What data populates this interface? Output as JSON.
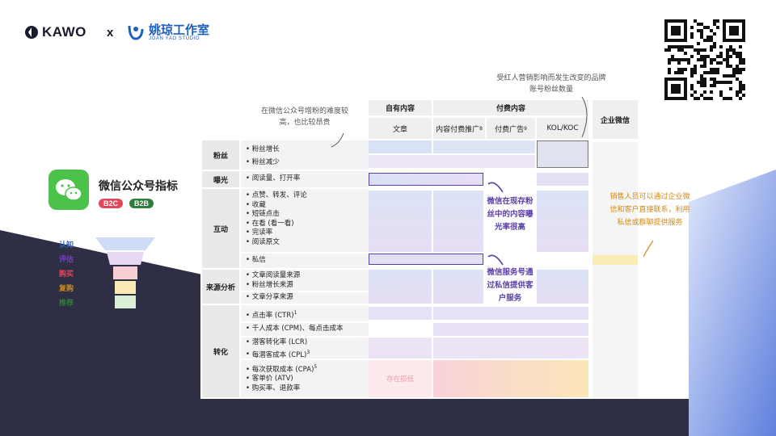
{
  "header": {
    "kawo_brand": "KAWO",
    "cross": "x",
    "partner_cn": "姚琼工作室",
    "partner_en": "JOAN YAO STUDIO"
  },
  "wechat": {
    "title": "微信公众号指标",
    "badge_b2c": "B2C",
    "badge_b2b": "B2B"
  },
  "funnel": [
    "认知",
    "评估",
    "购买",
    "复购",
    "推荐"
  ],
  "notes": {
    "top_left": "在微信公众号增粉的难度较高，也比较昂贵",
    "top_right": "受红人营销影响而发生改变的品牌账号粉丝数量",
    "exposure": "微信在现存粉丝中的内容曝光率很高",
    "service": "微信服务号通过私信提供客户服务",
    "sales": "销售人员可以通过企业微信和客户直接联系，利用私信或群聊提供服务"
  },
  "table": {
    "group_owned": "自有内容",
    "group_paid": "付费内容",
    "col_article": "文章",
    "col_paid_promo": "内容付费推广",
    "col_paid_promo_sup": "8",
    "col_paid_ads": "付费广告",
    "col_paid_ads_sup": "9",
    "col_kol": "KOL/KOC",
    "col_enterprise": "企业微信",
    "cat_fans": "粉丝",
    "cat_exposure": "曝光",
    "cat_engagement": "互动",
    "cat_source": "来源分析",
    "cat_conversion": "转化",
    "m_fans": [
      "粉丝增长",
      "粉丝减少"
    ],
    "m_exposure": [
      "阅读量、打开率"
    ],
    "m_engage": [
      "点赞、转发、评论",
      "收藏",
      "短链点击",
      "在看 (看一看)",
      "完读率",
      "阅读原文"
    ],
    "m_dm": [
      "私信"
    ],
    "m_source": [
      "文章阅读量来源",
      "粉丝增长来源"
    ],
    "m_source2": [
      "文章分享来源"
    ],
    "m_conv1": [
      "点击率 (CTR)"
    ],
    "m_conv1_sup": "1",
    "m_conv2": [
      "千人成本 (CPM)、每点击成本"
    ],
    "m_conv3": [
      "潜客转化率 (LCR)",
      "每潜客成本 (CPL)"
    ],
    "m_conv3_sup": "3",
    "m_conv4": [
      "每次获取成本 (CPA)",
      "客单价 (ATV)",
      "购买率、退款率"
    ],
    "m_conv4_sup": "5",
    "existing_loss": "存在损低"
  },
  "colors": {
    "wechat_green": "#4cc24a",
    "b2c_red": "#e0485a",
    "b2b_green": "#2f7d3a",
    "highlight_purple": "#5a3fa8",
    "note_orange": "#d08a1a",
    "dark_bg": "#2e2f45",
    "blue_bg": "#6f8fe0"
  }
}
